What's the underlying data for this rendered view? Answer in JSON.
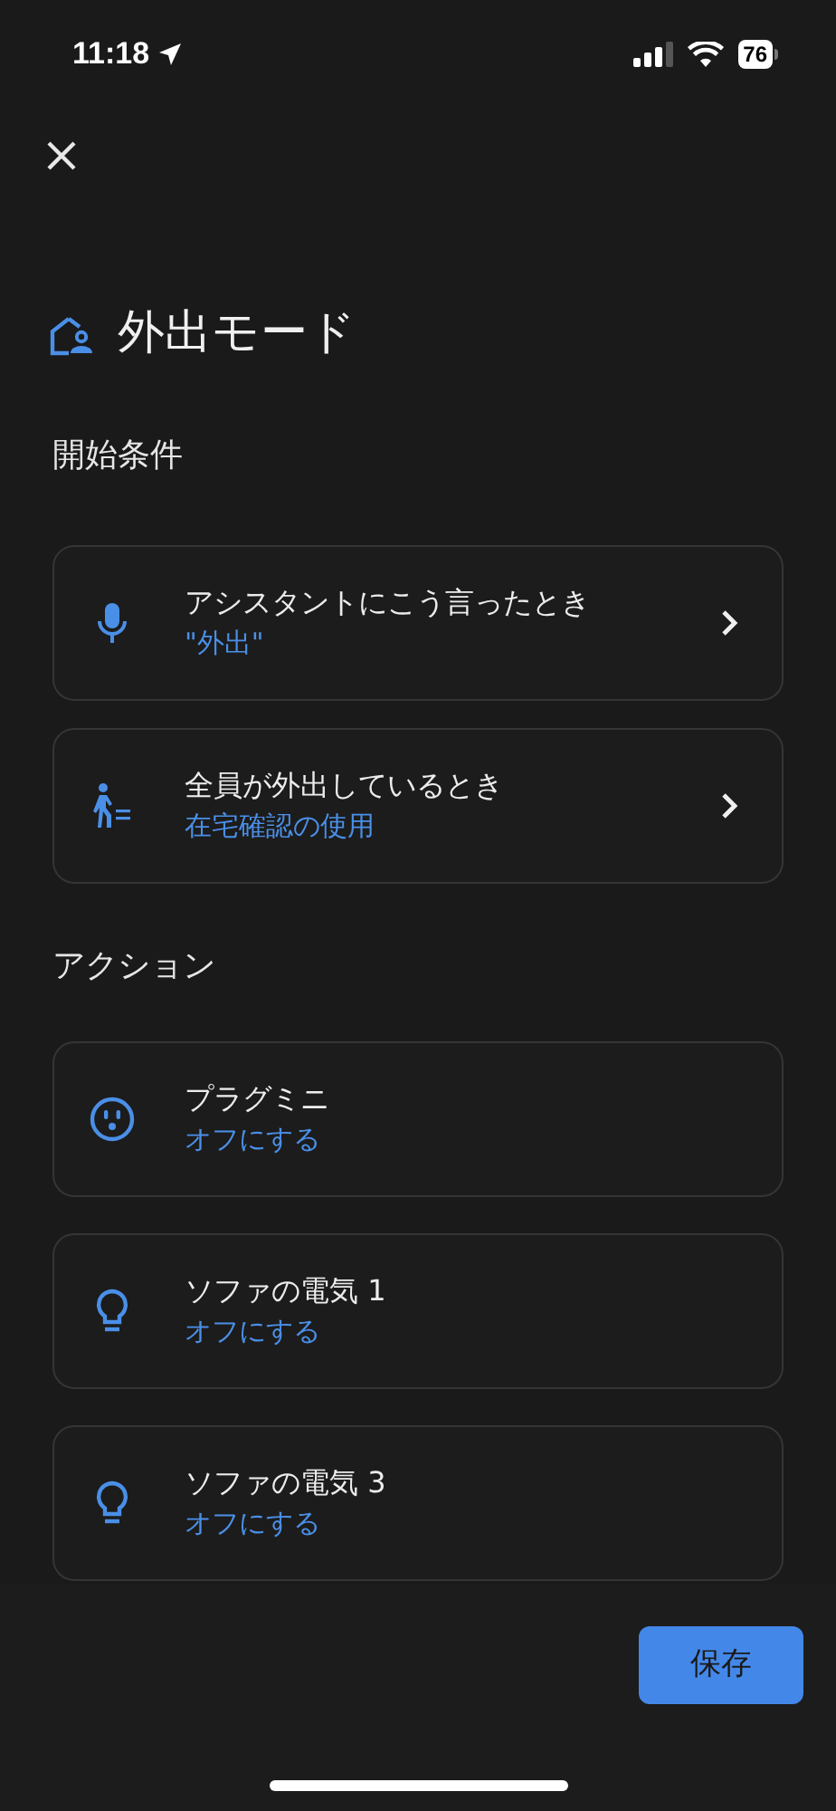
{
  "status_bar": {
    "time": "11:18",
    "battery": "76"
  },
  "title": "外出モード",
  "starters": {
    "heading": "開始条件",
    "items": [
      {
        "kind": "mic",
        "label": "アシスタントにこう言ったとき",
        "detail": "\"外出\"",
        "chevron": true
      },
      {
        "kind": "walker",
        "label": "全員が外出しているとき",
        "detail": "在宅確認の使用",
        "chevron": true
      }
    ]
  },
  "actions": {
    "heading": "アクション",
    "items": [
      {
        "kind": "outlet",
        "label": "プラグミニ",
        "detail": "オフにする",
        "chevron": false
      },
      {
        "kind": "bulb",
        "label": "ソファの電気 1",
        "detail": "オフにする",
        "chevron": false
      },
      {
        "kind": "bulb",
        "label": "ソファの電気 3",
        "detail": "オフにする",
        "chevron": false
      }
    ]
  },
  "save_button": "保存"
}
